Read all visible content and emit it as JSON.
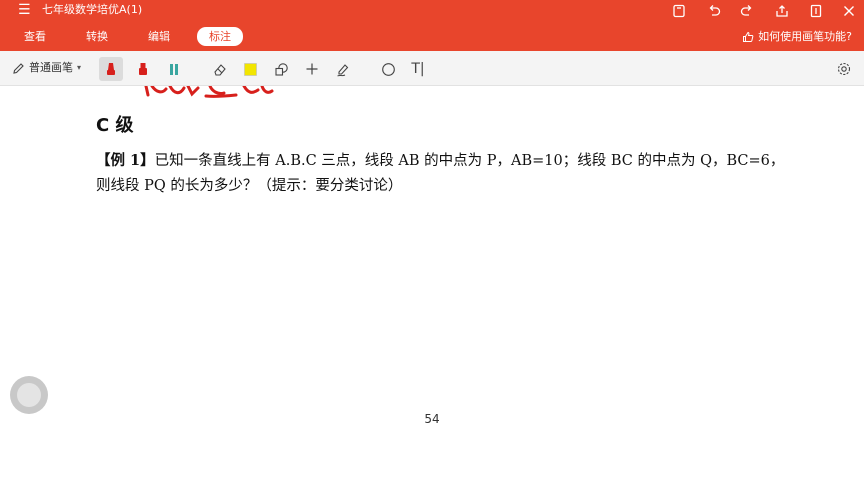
{
  "titlebar": {
    "title": "七年级数学培优A(1)",
    "icons": [
      "menu-icon",
      "save-icon",
      "undo-icon",
      "redo-icon",
      "share-icon",
      "page-icon",
      "close-icon"
    ]
  },
  "menubar": {
    "tabs": [
      {
        "label": "查看"
      },
      {
        "label": "转换"
      },
      {
        "label": "编辑"
      },
      {
        "label": "标注"
      }
    ],
    "active_tab": "标注",
    "help_text": "如何使用画笔功能?"
  },
  "toolbar": {
    "pen_type": "普通画笔",
    "tools": [
      "pen-red-icon",
      "marker-red-icon",
      "highlighter-teal-icon",
      "eraser-icon",
      "color-swatch-icon",
      "shape-icon",
      "plus-icon",
      "sign-pen-icon",
      "circle-icon",
      "text-tool-icon",
      "settings-icon"
    ],
    "text_tool_label": "T|"
  },
  "colors": {
    "brand": "#e8452c",
    "pen_red": "#d7201c",
    "highlighter_teal": "#3aa6a0",
    "swatch_yellow": "#f2e500"
  },
  "document": {
    "heading": "C 级",
    "problem_label": "【例 1】",
    "problem_text": "已知一条直线上有 A.B.C 三点，线段 AB 的中点为 P，AB=10；线段 BC 的中点为 Q，BC=6，则线段 PQ 的长为多少？（提示：要分类讨论）",
    "page_number": "54"
  }
}
